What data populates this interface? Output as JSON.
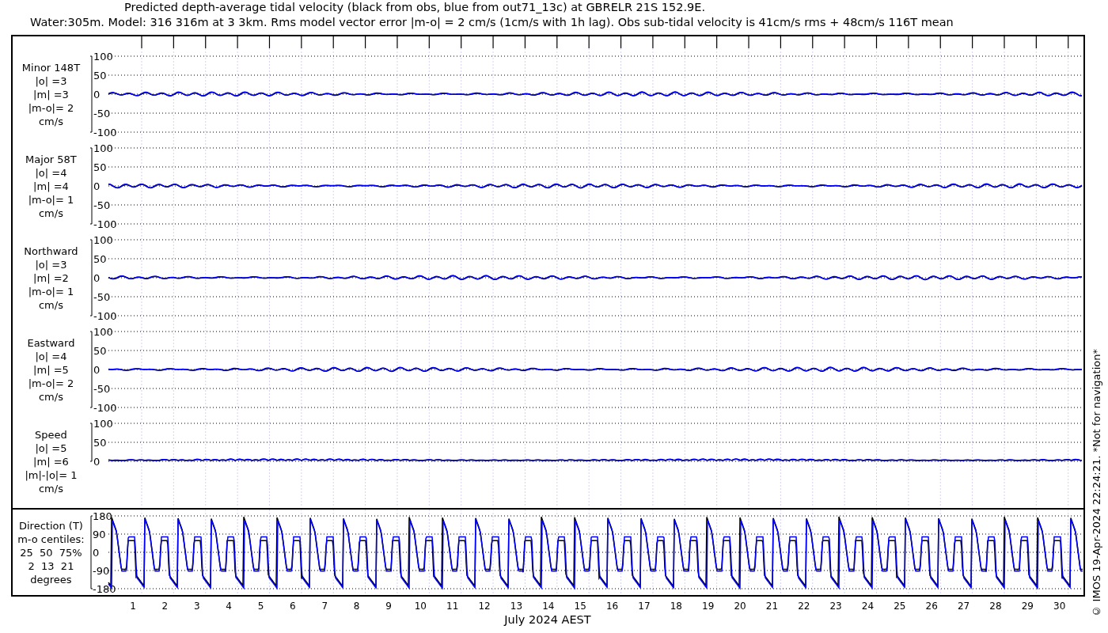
{
  "title": [
    "Predicted depth-average tidal velocity (black from obs, blue from out71_13c) at GBRELR 21S 152.9E.",
    "Water:305m. Model: 316 316m at 3 3km. Rms model vector error |m-o| = 2 cm/s (1cm/s with 1h lag). Obs sub-tidal velocity is 41cm/s rms + 48cm/s 116T mean"
  ],
  "panels": [
    {
      "kind": "velocity",
      "lines": [
        "Minor 148T",
        "|o| =3",
        "|m| =3",
        "|m-o|= 2",
        "cm/s"
      ],
      "yticks": [
        "100",
        "50",
        "0",
        "-50",
        "-100"
      ]
    },
    {
      "kind": "velocity",
      "lines": [
        "Major 58T",
        "|o| =4",
        "|m| =4",
        "|m-o|= 1",
        "cm/s"
      ],
      "yticks": [
        "100",
        "50",
        "0",
        "-50",
        "-100"
      ]
    },
    {
      "kind": "velocity",
      "lines": [
        "Northward",
        "|o| =3",
        "|m| =2",
        "|m-o|= 1",
        "cm/s"
      ],
      "yticks": [
        "100",
        "50",
        "0",
        "-50",
        "-100"
      ]
    },
    {
      "kind": "velocity",
      "lines": [
        "Eastward",
        "|o| =4",
        "|m| =5",
        "|m-o|= 2",
        "cm/s"
      ],
      "yticks": [
        "100",
        "50",
        "0",
        "-50",
        "-100"
      ]
    },
    {
      "kind": "speed",
      "lines": [
        "Speed",
        "|o| =5",
        "|m| =6",
        "|m|-|o|= 1",
        "cm/s"
      ],
      "yticks": [
        "100",
        "50",
        "0"
      ]
    }
  ],
  "direction_panel": {
    "lines": [
      "Direction (T)",
      "m-o centiles:",
      "25  50  75%",
      "2  13  21",
      "degrees"
    ],
    "yticks": [
      "180",
      "90",
      "0",
      "-90",
      "-180"
    ]
  },
  "days": [
    "1",
    "2",
    "3",
    "4",
    "5",
    "6",
    "7",
    "8",
    "9",
    "10",
    "11",
    "12",
    "13",
    "14",
    "15",
    "16",
    "17",
    "18",
    "19",
    "20",
    "21",
    "22",
    "23",
    "24",
    "25",
    "26",
    "27",
    "28",
    "29",
    "30"
  ],
  "xlabel": "July 2024 AEST",
  "credit": "© IMOS 19-Apr-2024 22:24:21. *Not for navigation*"
}
